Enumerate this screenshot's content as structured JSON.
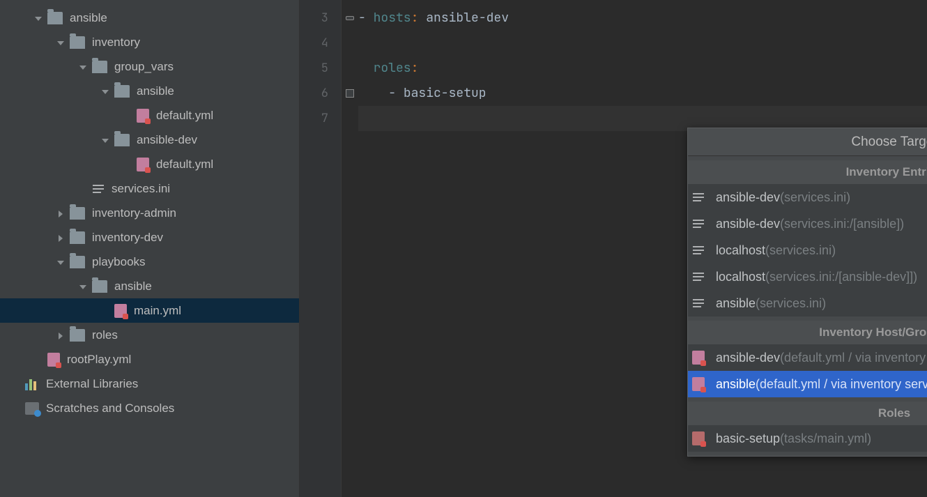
{
  "tree": [
    {
      "indent": 34,
      "chev": "down",
      "icon": "folder",
      "label": "ansible",
      "sel": false
    },
    {
      "indent": 66,
      "chev": "down",
      "icon": "folder",
      "label": "inventory",
      "sel": false
    },
    {
      "indent": 98,
      "chev": "down",
      "icon": "folder",
      "label": "group_vars",
      "sel": false
    },
    {
      "indent": 130,
      "chev": "down",
      "icon": "folder",
      "label": "ansible",
      "sel": false
    },
    {
      "indent": 162,
      "chev": "blank",
      "icon": "yml",
      "label": "default.yml",
      "sel": false
    },
    {
      "indent": 130,
      "chev": "down",
      "icon": "folder",
      "label": "ansible-dev",
      "sel": false
    },
    {
      "indent": 162,
      "chev": "blank",
      "icon": "yml",
      "label": "default.yml",
      "sel": false
    },
    {
      "indent": 98,
      "chev": "blank",
      "icon": "ini",
      "label": "services.ini",
      "sel": false
    },
    {
      "indent": 66,
      "chev": "right",
      "icon": "folder",
      "label": "inventory-admin",
      "sel": false
    },
    {
      "indent": 66,
      "chev": "right",
      "icon": "folder",
      "label": "inventory-dev",
      "sel": false
    },
    {
      "indent": 66,
      "chev": "down",
      "icon": "folder",
      "label": "playbooks",
      "sel": false
    },
    {
      "indent": 98,
      "chev": "down",
      "icon": "folder",
      "label": "ansible",
      "sel": false
    },
    {
      "indent": 130,
      "chev": "blank",
      "icon": "yml",
      "label": "main.yml",
      "sel": true
    },
    {
      "indent": 66,
      "chev": "right",
      "icon": "folder",
      "label": "roles",
      "sel": false
    },
    {
      "indent": 34,
      "chev": "blank",
      "icon": "yml",
      "label": "rootPlay.yml",
      "sel": false
    },
    {
      "indent": 2,
      "chev": "blank",
      "icon": "extlib",
      "label": "External Libraries",
      "sel": false
    },
    {
      "indent": 2,
      "chev": "blank",
      "icon": "scratch",
      "label": "Scratches and Consoles",
      "sel": false
    }
  ],
  "gutter": [
    "3",
    "4",
    "5",
    "6",
    "7"
  ],
  "code": {
    "l3_hosts": "hosts",
    "l3_c": ": ",
    "l3_v": "ansible-dev",
    "l5_roles": "roles",
    "l5_c": ":",
    "l6_v": "basic-setup"
  },
  "popup": {
    "title": "Choose Target",
    "sections": [
      {
        "header": "Inventory Entries",
        "icon": "ini",
        "items": [
          {
            "main": "ansible-dev",
            "dim": " (services.ini)",
            "sel": false
          },
          {
            "main": "ansible-dev",
            "dim": " (services.ini:/[ansible])",
            "sel": false
          },
          {
            "main": "localhost",
            "dim": " (services.ini)",
            "sel": false
          },
          {
            "main": "localhost",
            "dim": " (services.ini:/[ansible-dev]])",
            "sel": false
          },
          {
            "main": "ansible",
            "dim": " (services.ini)",
            "sel": false
          }
        ]
      },
      {
        "header": "Inventory Host/Group Vars",
        "icon": "yml",
        "items": [
          {
            "main": "ansible-dev",
            "dim": " (default.yml / via inventory services.ini)",
            "sel": false
          },
          {
            "main": "ansible",
            "dim": " (default.yml / via inventory services.ini)",
            "sel": true
          }
        ]
      },
      {
        "header": "Roles",
        "icon": "role",
        "items": [
          {
            "main": "basic-setup",
            "dim": " (tasks/main.yml)",
            "sel": false
          }
        ]
      }
    ]
  }
}
